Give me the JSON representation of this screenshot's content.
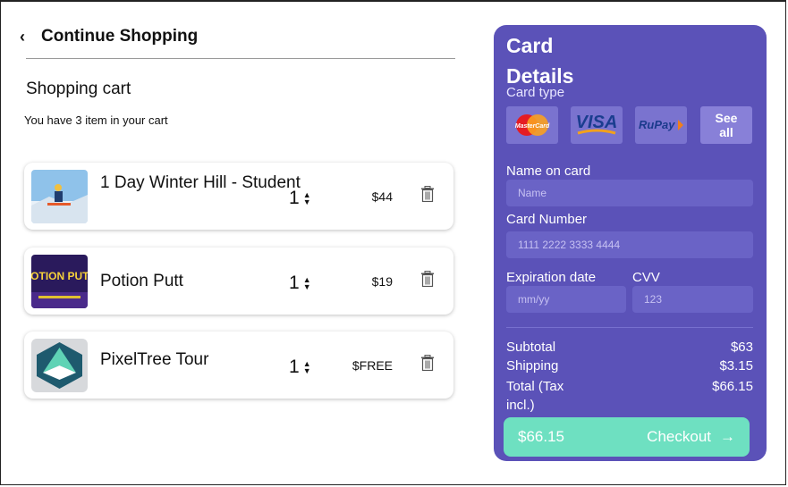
{
  "nav": {
    "back_label": "Continue Shopping"
  },
  "cart": {
    "title": "Shopping cart",
    "subtitle": "You have 3 item in your cart",
    "items": [
      {
        "name": "1 Day Winter Hill - Student",
        "qty": "1",
        "price": "$44"
      },
      {
        "name": "Potion Putt",
        "qty": "1",
        "price": "$19",
        "thumb_text": "POTION PUTT"
      },
      {
        "name": "PixelTree Tour",
        "qty": "1",
        "price": "$FREE"
      }
    ]
  },
  "card": {
    "title": "Card Details",
    "type_label": "Card type",
    "types": [
      "MasterCard",
      "VISA",
      "RuPay",
      "See all"
    ],
    "name_label": "Name on card",
    "name_placeholder": "Name",
    "number_label": "Card Number",
    "number_placeholder": "1111 2222 3333 4444",
    "exp_label": "Expiration date",
    "exp_placeholder": "mm/yy",
    "cvv_label": "CVV",
    "cvv_placeholder": "123",
    "subtotal_label": "Subtotal",
    "subtotal_value": "$63",
    "shipping_label": "Shipping",
    "shipping_value": "$3.15",
    "total_label": "Total (Tax incl.)",
    "total_value": "$66.15",
    "checkout_amount": "$66.15",
    "checkout_label": "Checkout",
    "colors": {
      "card_bg": "#5b52b8",
      "button": "#6ee0c1"
    }
  }
}
